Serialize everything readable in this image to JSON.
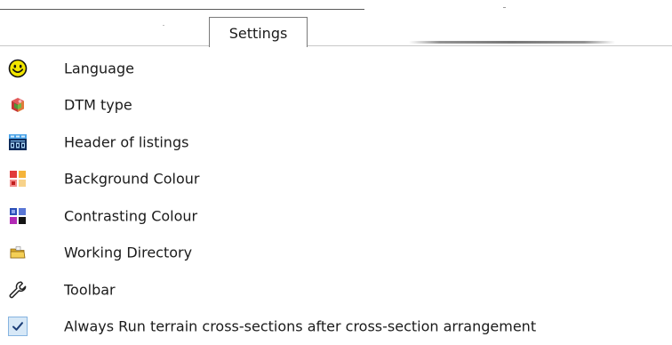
{
  "tabs": {
    "settings_label": "Settings"
  },
  "menu": {
    "items": [
      {
        "label": "Language",
        "icon": "smiley-icon"
      },
      {
        "label": "DTM type",
        "icon": "dtm-cube-icon"
      },
      {
        "label": "Header of listings",
        "icon": "listing-header-icon"
      },
      {
        "label": "Background Colour",
        "icon": "background-colour-icon"
      },
      {
        "label": "Contrasting Colour",
        "icon": "contrasting-colour-icon"
      },
      {
        "label": "Working Directory",
        "icon": "folder-icon"
      },
      {
        "label": "Toolbar",
        "icon": "wrench-icon"
      },
      {
        "label": "Always Run terrain cross-sections after cross-section arrangement",
        "icon": "checkmark-icon",
        "checked": true
      }
    ]
  },
  "colors": {
    "smiley_yellow": "#f2e600",
    "check_bg": "#d7e8f7",
    "check_border": "#86b4e0",
    "check_mark": "#1c3e78"
  }
}
